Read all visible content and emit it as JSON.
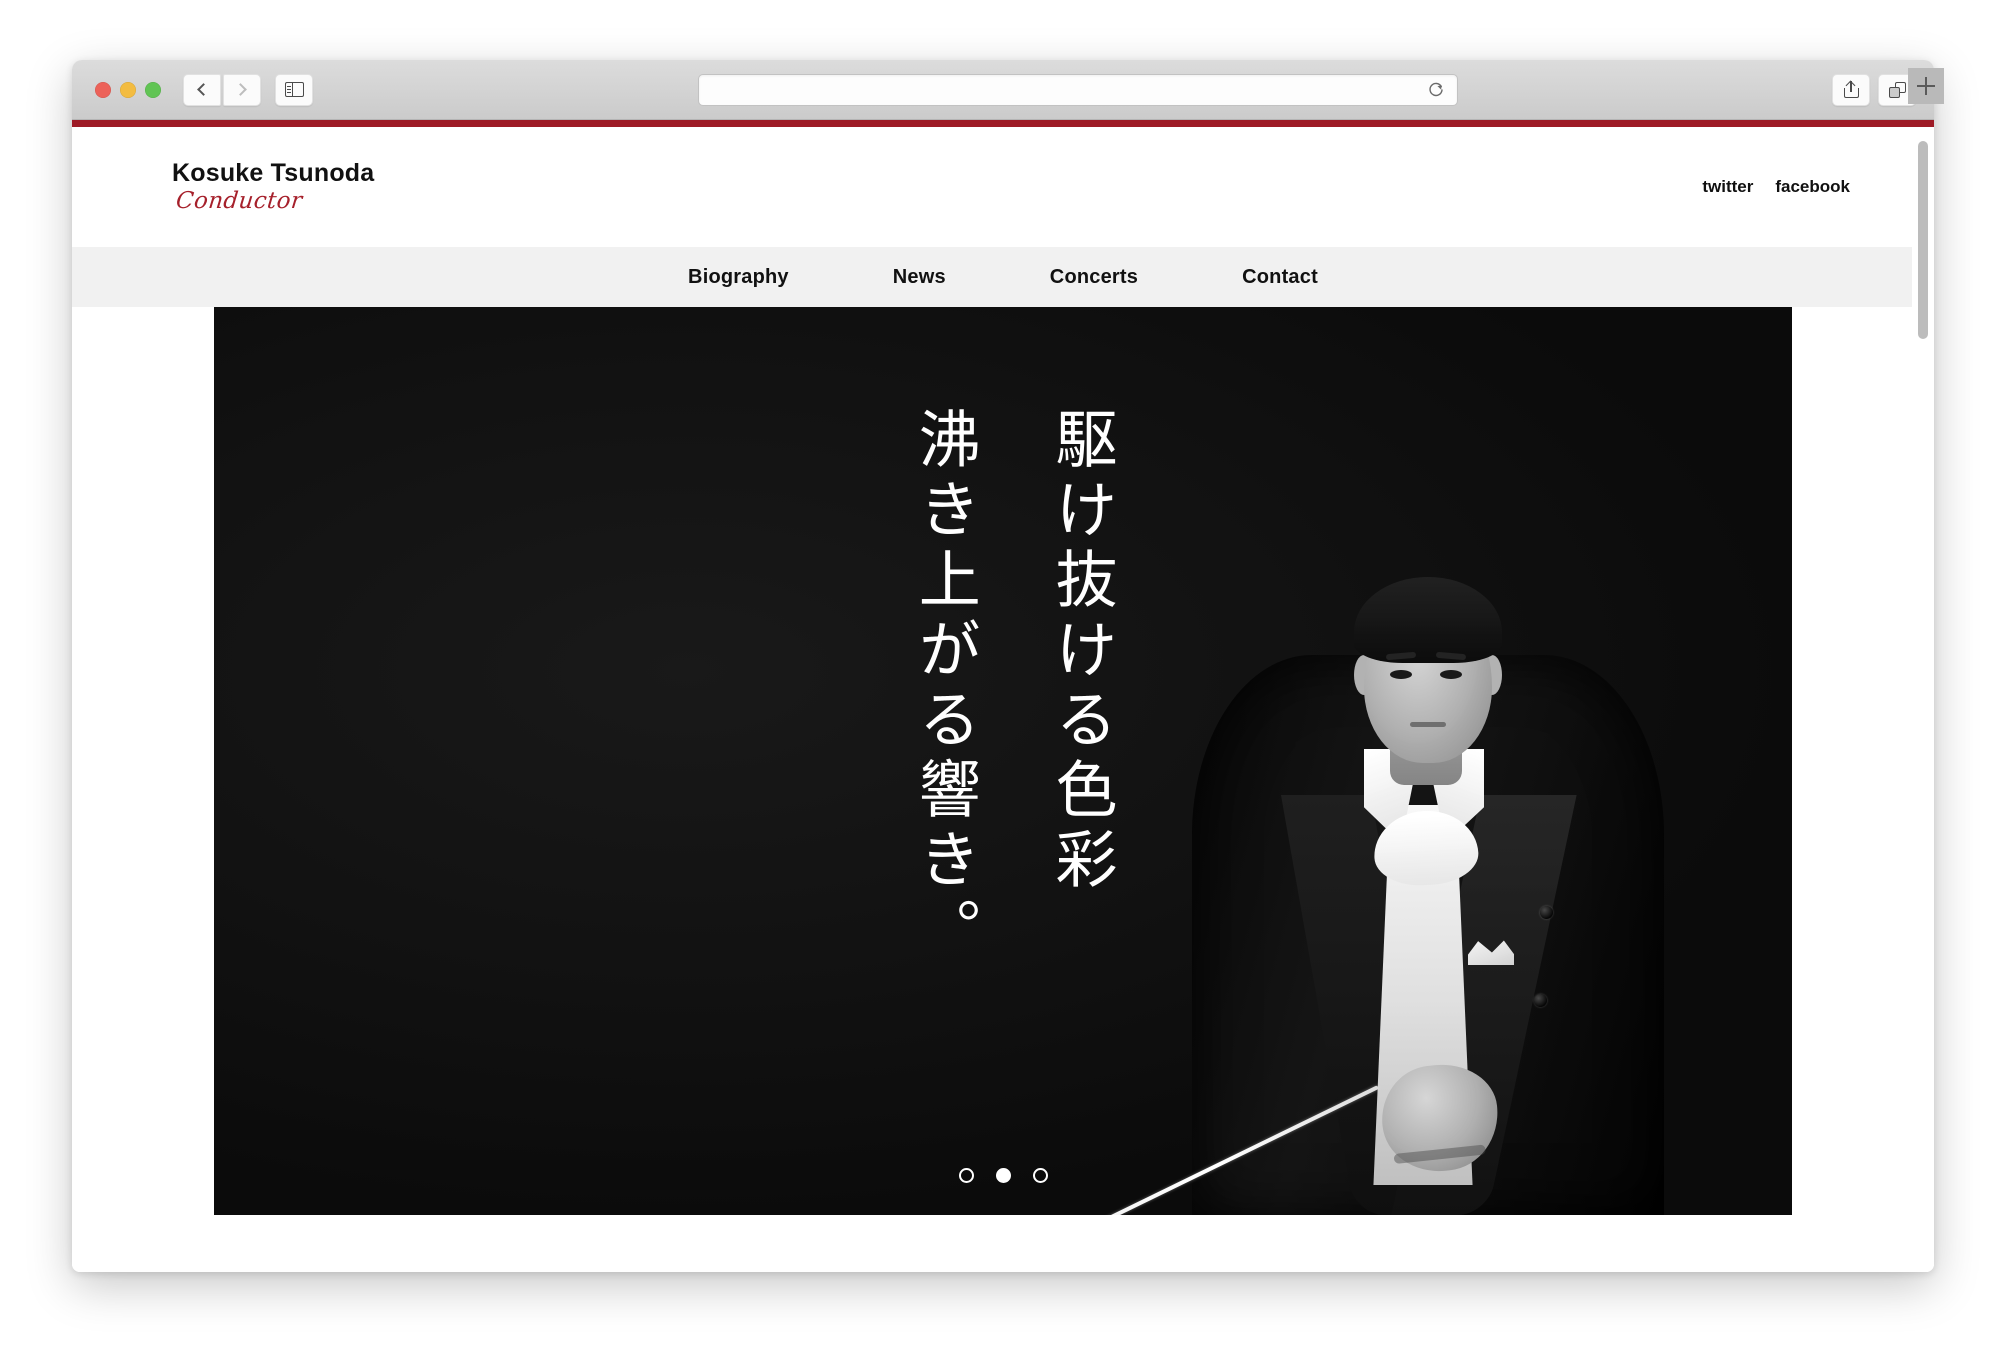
{
  "browser": {
    "window_controls": [
      {
        "name": "close",
        "color": "#ec6259"
      },
      {
        "name": "minimize",
        "color": "#f3bc41"
      },
      {
        "name": "zoom",
        "color": "#61c454"
      }
    ],
    "back_button_label": "Back",
    "forward_button_label": "Forward",
    "sidebar_button_label": "Show Sidebar",
    "address_bar": {
      "value": "",
      "placeholder": ""
    },
    "reload_button_label": "Reload this page",
    "share_button_label": "Share",
    "tabs_button_label": "Show Tab Overview",
    "new_tab_button_label": "+",
    "accent_color": "#9e1b26"
  },
  "site": {
    "header": {
      "brand_name": "Kosuke Tsunoda",
      "brand_role": "Conductor",
      "brand_role_color": "#a6202b",
      "social": [
        {
          "label": "twitter"
        },
        {
          "label": "facebook"
        }
      ]
    },
    "nav": {
      "items": [
        {
          "label": "Biography"
        },
        {
          "label": "News"
        },
        {
          "label": "Concerts"
        },
        {
          "label": "Contact"
        }
      ]
    },
    "hero": {
      "background_color": "#111111",
      "headline_lines": [
        "駆け抜ける色彩",
        "沸き上がる響き。"
      ],
      "portrait_alt": "Conductor in white tie holding a baton",
      "carousel": {
        "total_slides": 3,
        "active_slide": 2,
        "dots": [
          {
            "active": false
          },
          {
            "active": true
          },
          {
            "active": false
          }
        ]
      }
    }
  }
}
